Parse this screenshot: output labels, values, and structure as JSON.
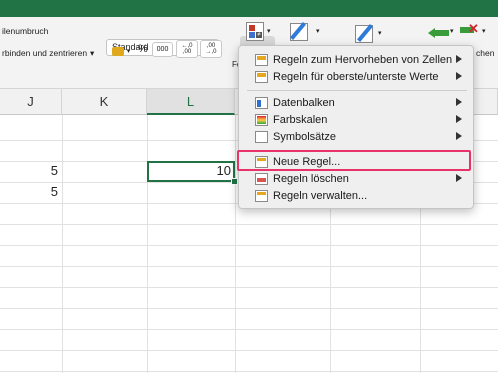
{
  "ribbon": {
    "wrap_text": "ilenumbruch",
    "merge_center": "rbinden und zentrieren",
    "number_format": "Standard",
    "percent": "%",
    "thousands": "000",
    "inc_decimal": "←,0\n,00",
    "dec_decimal": ",00\n→,0",
    "cond_format_short": "Fo",
    "delete_short": "chen"
  },
  "columns": [
    "J",
    "K",
    "L"
  ],
  "cells": {
    "j_row1": "5",
    "j_row2": "5",
    "l_row1": "10"
  },
  "menu": {
    "items": [
      {
        "label": "Regeln zum Hervorheben von Zellen",
        "icon": "highlight-cells-rules-icon",
        "submenu": true
      },
      {
        "label": "Regeln für oberste/unterste Werte",
        "icon": "top-bottom-rules-icon",
        "submenu": true
      },
      {
        "label": "Datenbalken",
        "icon": "data-bars-icon",
        "submenu": true
      },
      {
        "label": "Farbskalen",
        "icon": "color-scales-icon",
        "submenu": true
      },
      {
        "label": "Symbolsätze",
        "icon": "icon-sets-icon",
        "submenu": true
      },
      {
        "label": "Neue Regel...",
        "icon": "new-rule-icon",
        "submenu": false
      },
      {
        "label": "Regeln löschen",
        "icon": "clear-rules-icon",
        "submenu": true
      },
      {
        "label": "Regeln verwalten...",
        "icon": "manage-rules-icon",
        "submenu": false
      }
    ]
  },
  "colors": {
    "accent": "#217346",
    "highlight": "#e8336a"
  }
}
